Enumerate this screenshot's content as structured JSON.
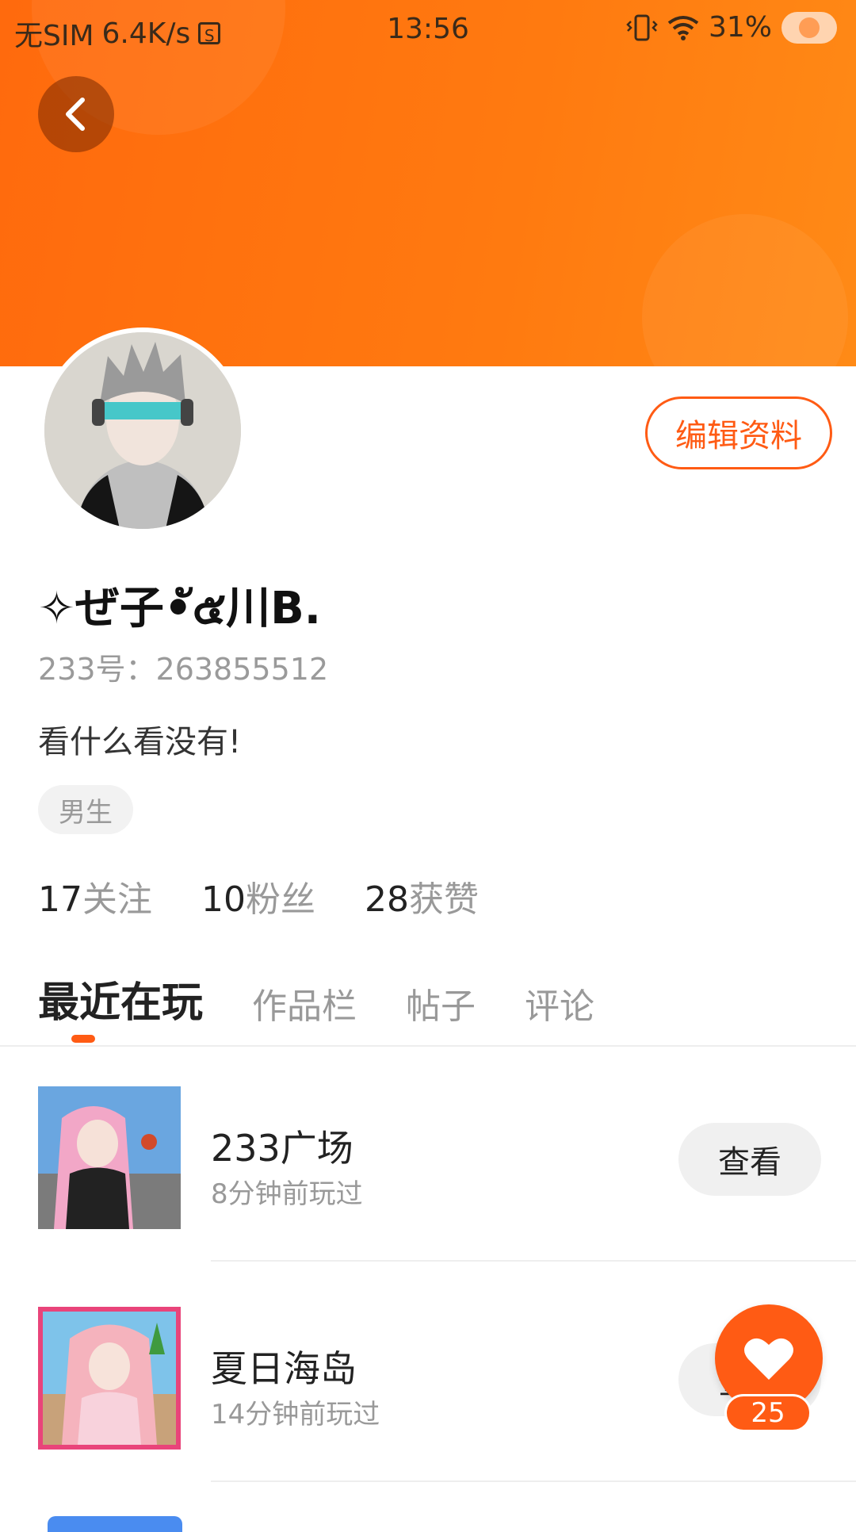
{
  "status_bar": {
    "carrier": "无SIM",
    "network_speed": "6.4K/s",
    "sim_icon_glyph": "S",
    "time": "13:56",
    "battery": "31%"
  },
  "profile": {
    "username": "✧ぜ子•ั๕川Β.",
    "id_text": "233号：263855512",
    "bio": "看什么看没有!",
    "gender": "男生",
    "edit_label": "编辑资料"
  },
  "stats": [
    {
      "num": "17",
      "label": "关注"
    },
    {
      "num": "10",
      "label": "粉丝"
    },
    {
      "num": "28",
      "label": "获赞"
    }
  ],
  "tabs": [
    {
      "label": "最近在玩",
      "active": true
    },
    {
      "label": "作品栏",
      "active": false
    },
    {
      "label": "帖子",
      "active": false
    },
    {
      "label": "评论",
      "active": false
    }
  ],
  "games": [
    {
      "title": "233广场",
      "subtitle": "8分钟前玩过",
      "button": "查看"
    },
    {
      "title": "夏日海岛",
      "subtitle": "14分钟前玩过",
      "button": "查看"
    }
  ],
  "like": {
    "count": "25"
  },
  "colors": {
    "accent": "#ff5b14",
    "header": "#ff6f10"
  }
}
